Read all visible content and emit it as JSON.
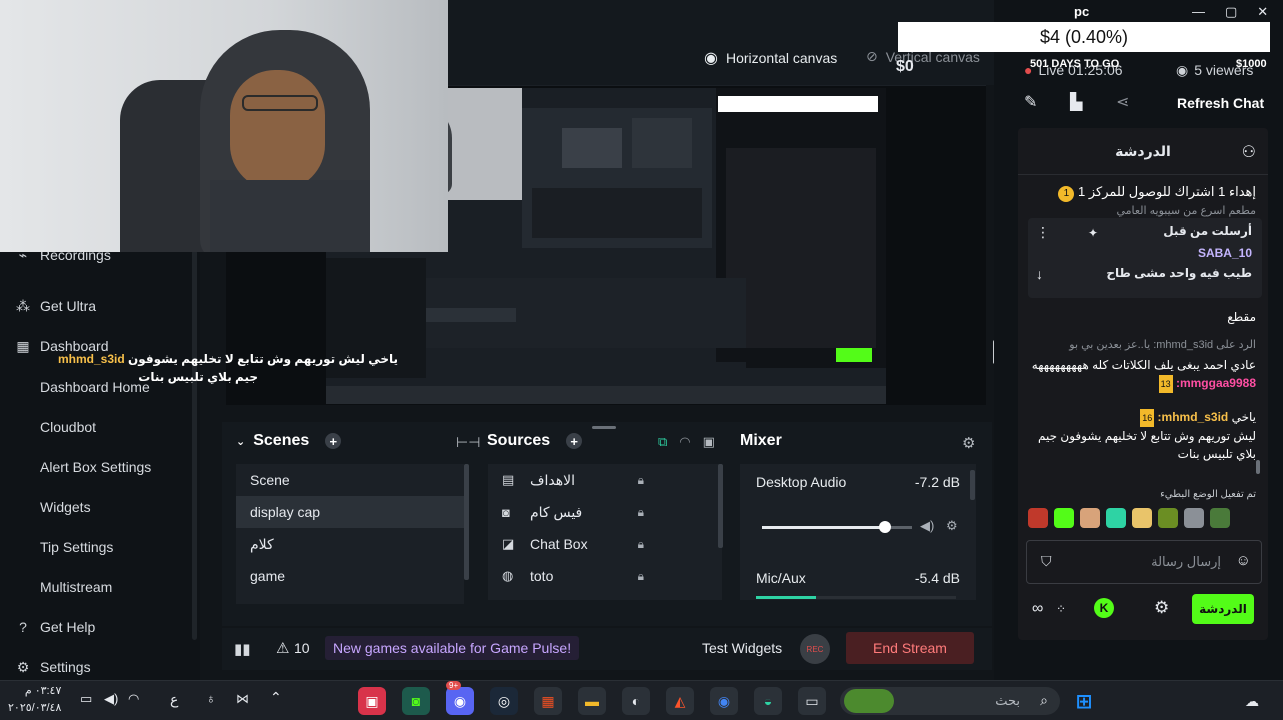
{
  "window": {
    "title": "pc"
  },
  "stream_overlay": {
    "donation_bar": "$4 (0.40%)",
    "goal_min": "$0",
    "goal_max": "$1000",
    "goal_days": "501 DAYS TO GO"
  },
  "canvas": {
    "horizontal": "Horizontal canvas",
    "vertical": "Vertical canvas"
  },
  "live": {
    "timer": "Live 01:25:06",
    "viewers": "5 viewers",
    "refresh": "Refresh Chat"
  },
  "sidebar": {
    "recordings": "Recordings",
    "get_ultra": "Get Ultra",
    "dashboard": "Dashboard",
    "dashboard_home": "Dashboard Home",
    "cloudbot": "Cloudbot",
    "alert_box": "Alert Box Settings",
    "widgets": "Widgets",
    "tip_settings": "Tip Settings",
    "multistream": "Multistream",
    "get_help": "Get Help",
    "settings": "Settings"
  },
  "overlay_chat": {
    "user": "mhmd_s3id",
    "line1": "ياخي ليش توريهم وش تتابع لا تخليهم يشوفون",
    "line2": "جيم بلاي تلبيس بنات"
  },
  "scenes": {
    "title": "Scenes",
    "items": [
      "Scene",
      "display cap",
      "كلام",
      "game"
    ],
    "selected": "display cap"
  },
  "sources": {
    "title": "Sources",
    "items": [
      {
        "icon": "calendar-icon",
        "label": "الاهداف"
      },
      {
        "icon": "webcam-icon",
        "label": "فيس كام"
      },
      {
        "icon": "chat-icon",
        "label": "Chat Box"
      },
      {
        "icon": "globe-icon",
        "label": "toto"
      }
    ]
  },
  "mixer": {
    "title": "Mixer",
    "channels": [
      {
        "name": "Desktop Audio",
        "db": "-7.2 dB",
        "level": 0.82
      },
      {
        "name": "Mic/Aux",
        "db": "-5.4 dB",
        "level": 0.3
      }
    ]
  },
  "footer": {
    "alerts_count": "10",
    "banner": "New games available for Game Pulse!",
    "test_widgets": "Test Widgets",
    "rec": "REC",
    "end_stream": "End Stream"
  },
  "chat": {
    "header": "الدردشة",
    "pinned_header": "إهداء 1 اشتراك للوصول للمركز 1",
    "pinned_by": "أرسلت من قبل",
    "pinned_user": "SABA_10",
    "pinned_text": "طيب فيه واحد مشى طاح",
    "partial_top": "مطعم اسرع من سيبويه العامي",
    "word": "مقطع",
    "reply_prefix": "الرد على mhmd_s3id: يا..عز بعدين بي بو",
    "m1_user": "mmggaa9988:",
    "m1_text": "عادي احمد يبغى يلف الكلاتات كله هههههههههه",
    "m1_badge": "13",
    "m2_user": "mhmd_s3id:",
    "m2_prefix": "ياخي",
    "m2_text": "ليش توريهم وش تتابع لا تخليهم يشوفون جيم بلاي تلبيس بنات",
    "m2_badge": "16",
    "emote_note": "تم تفعيل الوضع البطيء",
    "input_placeholder": "إرسال رسالة",
    "send": "الدردشة",
    "pin_badge": "1"
  },
  "taskbar": {
    "time": "٠٣:٤٧ م",
    "date": "٢٠٢٥/٠٣/٤٨",
    "lang": "ع",
    "search": "بحث",
    "badge": "9+"
  },
  "colors": {
    "accent_green": "#53fc18",
    "end_stream": "#e24d4d",
    "banner": "#8b5cf6"
  }
}
